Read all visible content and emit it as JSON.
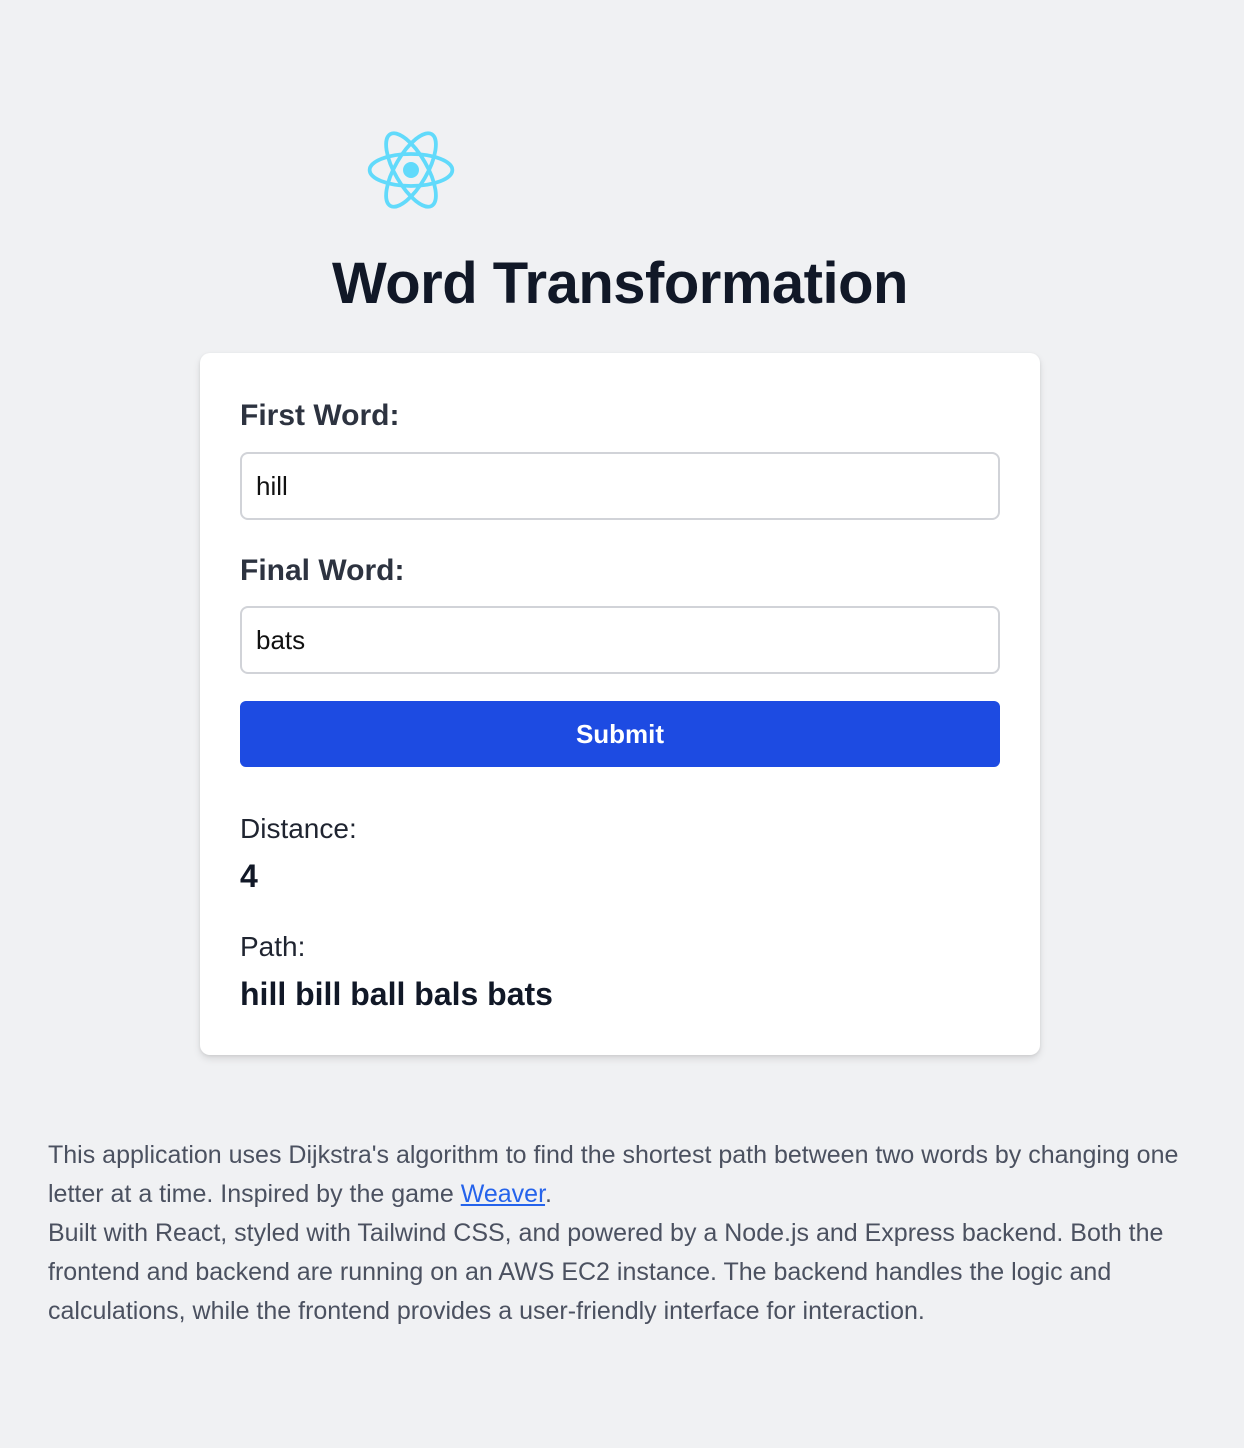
{
  "header": {
    "logo_icon": "react-atom-icon",
    "logo_color": "#61dafb",
    "title": "Word Transformation"
  },
  "form": {
    "first_word_label": "First Word:",
    "first_word_value": "hill",
    "final_word_label": "Final Word:",
    "final_word_value": "bats",
    "submit_label": "Submit",
    "submit_color": "#1d4be2"
  },
  "result": {
    "distance_label": "Distance:",
    "distance_value": "4",
    "path_label": "Path:",
    "path_value": "hill bill ball bals bats"
  },
  "footer": {
    "line1_before_link": "This application uses Dijkstra's algorithm to find the shortest path between two words by changing one letter at a time. Inspired by the game ",
    "link_text": "Weaver",
    "line1_after_link": ".",
    "line2": "Built with React, styled with Tailwind CSS, and powered by a Node.js and Express backend. Both the frontend and backend are running on an AWS EC2 instance. The backend handles the logic and calculations, while the frontend provides a user-friendly interface for interaction."
  }
}
